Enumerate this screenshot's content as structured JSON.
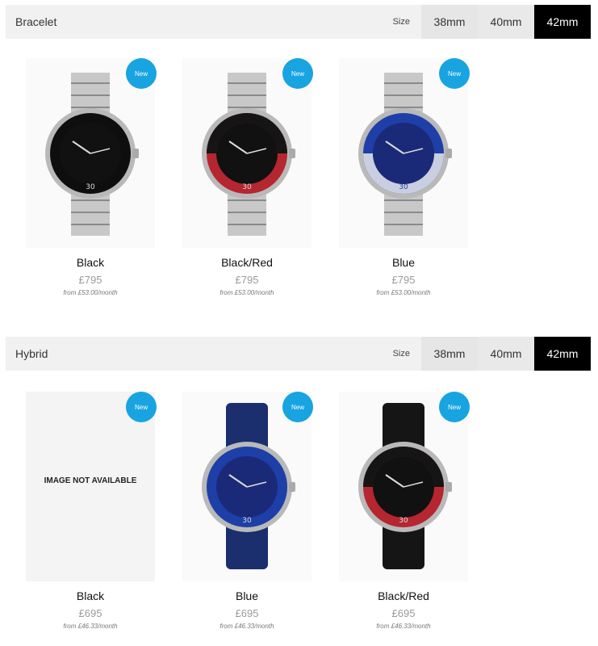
{
  "sections": [
    {
      "title": "Bracelet",
      "size_label": "Size",
      "sizes": [
        "38mm",
        "40mm",
        "42mm"
      ],
      "active_size": "42mm",
      "products": [
        {
          "name": "Black",
          "price": "£795",
          "finance": "from £53.00/month",
          "badge": "New",
          "bezel": "#0e0e0e",
          "dial": "#111111",
          "strap": "bracelet"
        },
        {
          "name": "Black/Red",
          "price": "£795",
          "finance": "from £53.00/month",
          "badge": "New",
          "bezel": "#b52630",
          "dial": "#111111",
          "strap": "bracelet"
        },
        {
          "name": "Blue",
          "price": "£795",
          "finance": "from £53.00/month",
          "badge": "New",
          "bezel": "#1e3fa8",
          "dial": "#1a2a78",
          "strap": "bracelet"
        }
      ]
    },
    {
      "title": "Hybrid",
      "size_label": "Size",
      "sizes": [
        "38mm",
        "40mm",
        "42mm"
      ],
      "active_size": "42mm",
      "products": [
        {
          "name": "Black",
          "price": "£695",
          "finance": "from £46.33/month",
          "badge": "New",
          "image_unavailable": "IMAGE NOT AVAILABLE"
        },
        {
          "name": "Blue",
          "price": "£695",
          "finance": "from £46.33/month",
          "badge": "New",
          "bezel": "#1e3fa8",
          "dial": "#1a2a78",
          "strap_color": "#1b2e6e"
        },
        {
          "name": "Black/Red",
          "price": "£695",
          "finance": "from £46.33/month",
          "badge": "New",
          "bezel": "#b52630",
          "dial": "#111111",
          "strap_color": "#151515"
        }
      ]
    }
  ],
  "colors": {
    "badge": "#18a4e0",
    "active_size_bg": "#000000",
    "bar_bg": "#f1f1f1"
  }
}
